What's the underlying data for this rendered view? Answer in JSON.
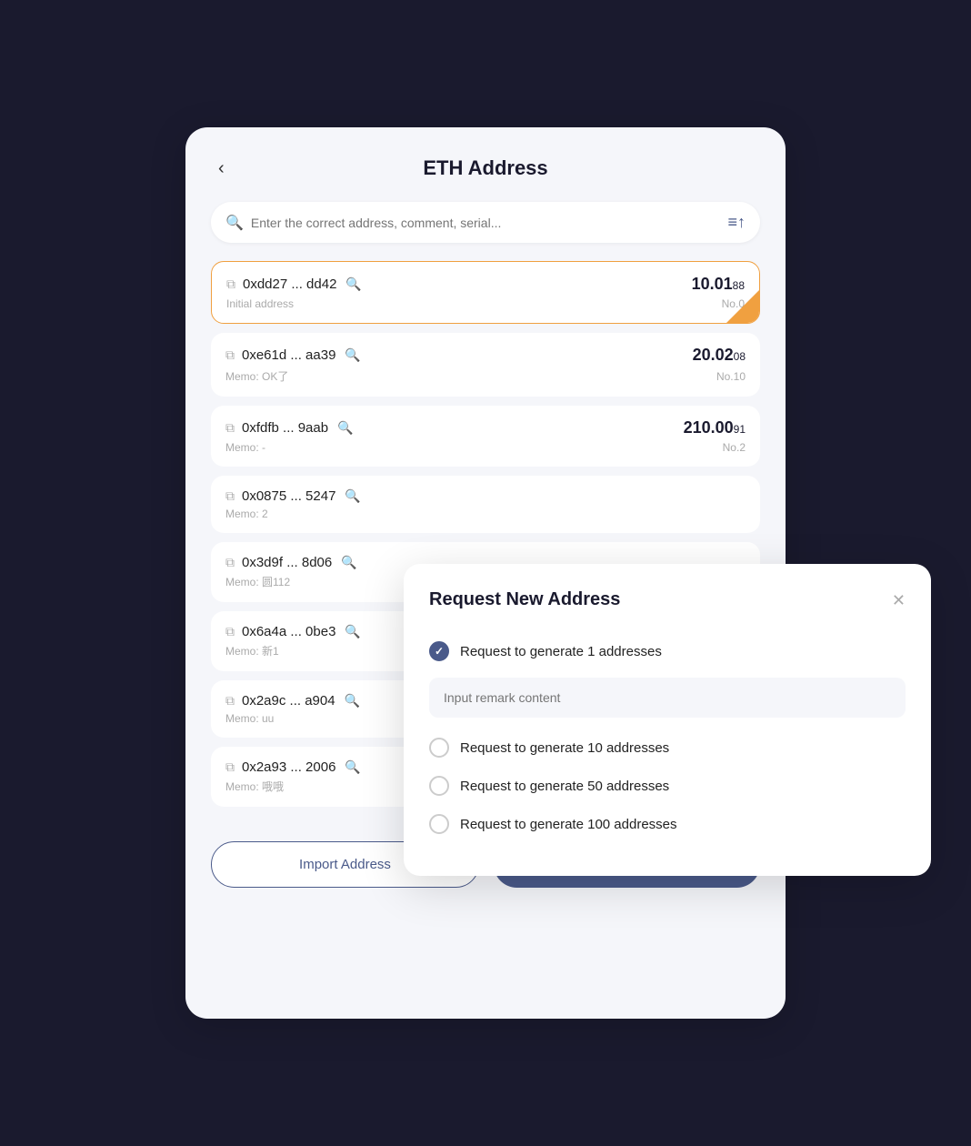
{
  "header": {
    "back_label": "‹",
    "title": "ETH Address"
  },
  "search": {
    "placeholder": "Enter the correct address, comment, serial..."
  },
  "filter_icon": "≡↑",
  "addresses": [
    {
      "address": "0xdd27 ... dd42",
      "memo": "Initial address",
      "amount_main": "10.01",
      "amount_decimal": "88",
      "number": "No.0",
      "active": true
    },
    {
      "address": "0xe61d ... aa39",
      "memo": "Memo: OK了",
      "amount_main": "20.02",
      "amount_decimal": "08",
      "number": "No.10",
      "active": false
    },
    {
      "address": "0xfdfb ... 9aab",
      "memo": "Memo: -",
      "amount_main": "210.00",
      "amount_decimal": "91",
      "number": "No.2",
      "active": false
    },
    {
      "address": "0x0875 ... 5247",
      "memo": "Memo: 2",
      "amount_main": "",
      "amount_decimal": "",
      "number": "",
      "active": false
    },
    {
      "address": "0x3d9f ... 8d06",
      "memo": "Memo: 圆112",
      "amount_main": "",
      "amount_decimal": "",
      "number": "",
      "active": false
    },
    {
      "address": "0x6a4a ... 0be3",
      "memo": "Memo: 新1",
      "amount_main": "",
      "amount_decimal": "",
      "number": "",
      "active": false
    },
    {
      "address": "0x2a9c ... a904",
      "memo": "Memo: uu",
      "amount_main": "",
      "amount_decimal": "",
      "number": "",
      "active": false
    },
    {
      "address": "0x2a93 ... 2006",
      "memo": "Memo: 哦哦",
      "amount_main": "",
      "amount_decimal": "",
      "number": "",
      "active": false
    }
  ],
  "buttons": {
    "import": "Import Address",
    "request": "Request New Address"
  },
  "modal": {
    "title": "Request New Address",
    "close_label": "✕",
    "remark_placeholder": "Input remark content",
    "options": [
      {
        "label": "Request to generate 1 addresses",
        "checked": true
      },
      {
        "label": "Request to generate 10 addresses",
        "checked": false
      },
      {
        "label": "Request to generate 50 addresses",
        "checked": false
      },
      {
        "label": "Request to generate 100 addresses",
        "checked": false
      }
    ]
  }
}
